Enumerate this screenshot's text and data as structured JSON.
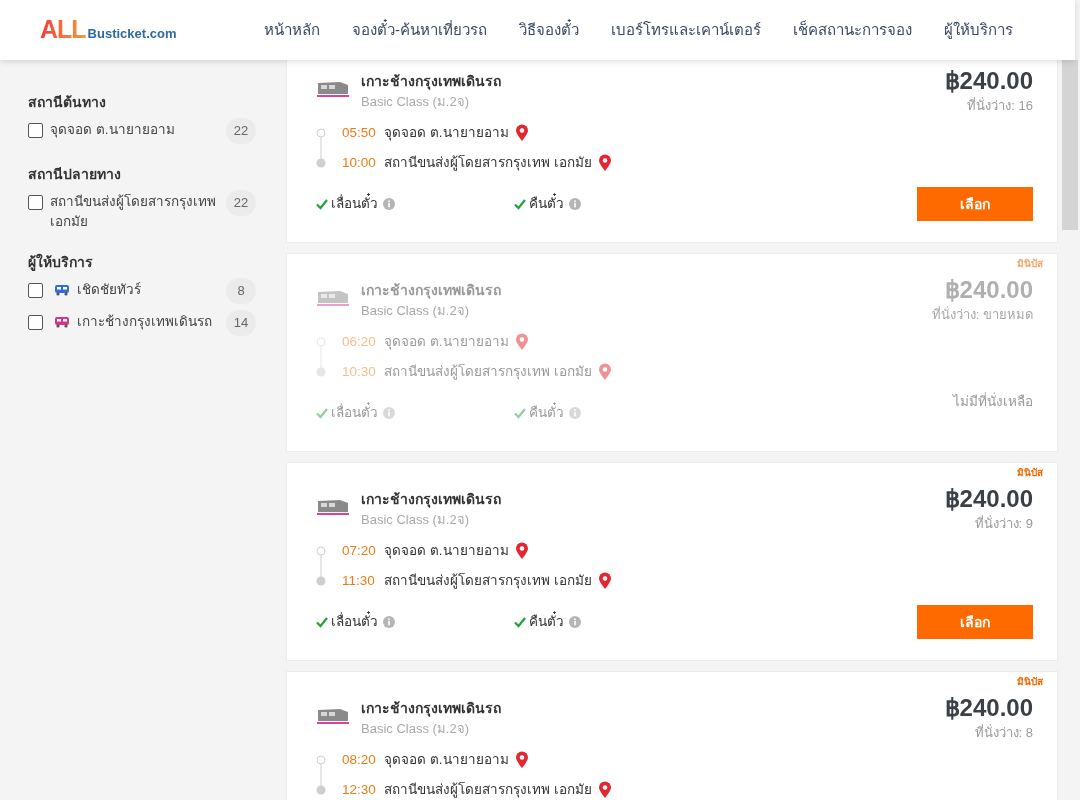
{
  "header": {
    "logo": {
      "primary": "ALL",
      "secondary": "Busticket.com"
    },
    "nav": [
      {
        "label": "หน้าหลัก"
      },
      {
        "label": "จองตั๋ว-ค้นหาเที่ยวรถ"
      },
      {
        "label": "วิธีจองตั๋ว"
      },
      {
        "label": "เบอร์โทรและเคาน์เตอร์"
      },
      {
        "label": "เช็คสถานะการจอง"
      },
      {
        "label": "ผู้ให้บริการ"
      }
    ]
  },
  "sidebar": {
    "groups": [
      {
        "title": "สถานีต้นทาง",
        "items": [
          {
            "kind": "plain",
            "label": "จุดจอด ต.นายายอาม",
            "count": "22",
            "checked": false
          }
        ]
      },
      {
        "title": "สถานีปลายทาง",
        "items": [
          {
            "kind": "plain",
            "label": "สถานีขนส่งผู้โดยสารกรุงเทพ เอกมัย",
            "count": "22",
            "checked": false
          }
        ]
      },
      {
        "title": "ผู้ให้บริการ",
        "items": [
          {
            "kind": "operator",
            "color": "#2f6fd6",
            "label": "เชิดชัยทัวร์",
            "count": "8",
            "checked": false
          },
          {
            "kind": "operator",
            "color": "#d6338a",
            "label": "เกาะช้างกรุงเทพเดินรถ",
            "count": "14",
            "checked": false
          }
        ]
      }
    ]
  },
  "trips": [
    {
      "operator": "เกาะช้างกรุงเทพเดินรถ",
      "class": "Basic Class (ม.2จ)",
      "sold_out": false,
      "depart_time": "05:50",
      "depart_stop": "จุดจอด ต.นายายอาม",
      "arrive_time": "10:00",
      "arrive_stop": "สถานีขนส่งผู้โดยสารกรุงเทพ เอกมัย",
      "features": [
        {
          "label": "เลื่อนตั๋ว",
          "included": true
        },
        {
          "label": "คืนตั๋ว",
          "included": true
        }
      ],
      "price": "฿240.00",
      "seats": "ที่นั่งว่าง: 16",
      "action": {
        "kind": "button",
        "label": "เลือก"
      }
    },
    {
      "badge": "มินิบัส",
      "operator": "เกาะช้างกรุงเทพเดินรถ",
      "class": "Basic Class (ม.2จ)",
      "sold_out": true,
      "depart_time": "06:20",
      "depart_stop": "จุดจอด ต.นายายอาม",
      "arrive_time": "10:30",
      "arrive_stop": "สถานีขนส่งผู้โดยสารกรุงเทพ เอกมัย",
      "features": [
        {
          "label": "เลื่อนตั๋ว",
          "included": true
        },
        {
          "label": "คืนตั๋ว",
          "included": true
        }
      ],
      "price": "฿240.00",
      "seats": "ที่นั่งว่าง: ขายหมด",
      "action": {
        "kind": "note",
        "label": "ไม่มีที่นั่งเหลือ"
      }
    },
    {
      "badge": "มินิบัส",
      "operator": "เกาะช้างกรุงเทพเดินรถ",
      "class": "Basic Class (ม.2จ)",
      "sold_out": false,
      "depart_time": "07:20",
      "depart_stop": "จุดจอด ต.นายายอาม",
      "arrive_time": "11:30",
      "arrive_stop": "สถานีขนส่งผู้โดยสารกรุงเทพ เอกมัย",
      "features": [
        {
          "label": "เลื่อนตั๋ว",
          "included": true
        },
        {
          "label": "คืนตั๋ว",
          "included": true
        }
      ],
      "price": "฿240.00",
      "seats": "ที่นั่งว่าง: 9",
      "action": {
        "kind": "button",
        "label": "เลือก"
      }
    },
    {
      "badge": "มินิบัส",
      "operator": "เกาะช้างกรุงเทพเดินรถ",
      "class": "Basic Class (ม.2จ)",
      "sold_out": false,
      "depart_time": "08:20",
      "depart_stop": "จุดจอด ต.นายายอาม",
      "arrive_time": "12:30",
      "arrive_stop": "สถานีขนส่งผู้โดยสารกรุงเทพ เอกมัย",
      "price": "฿240.00",
      "seats": "ที่นั่งว่าง: 8"
    }
  ]
}
